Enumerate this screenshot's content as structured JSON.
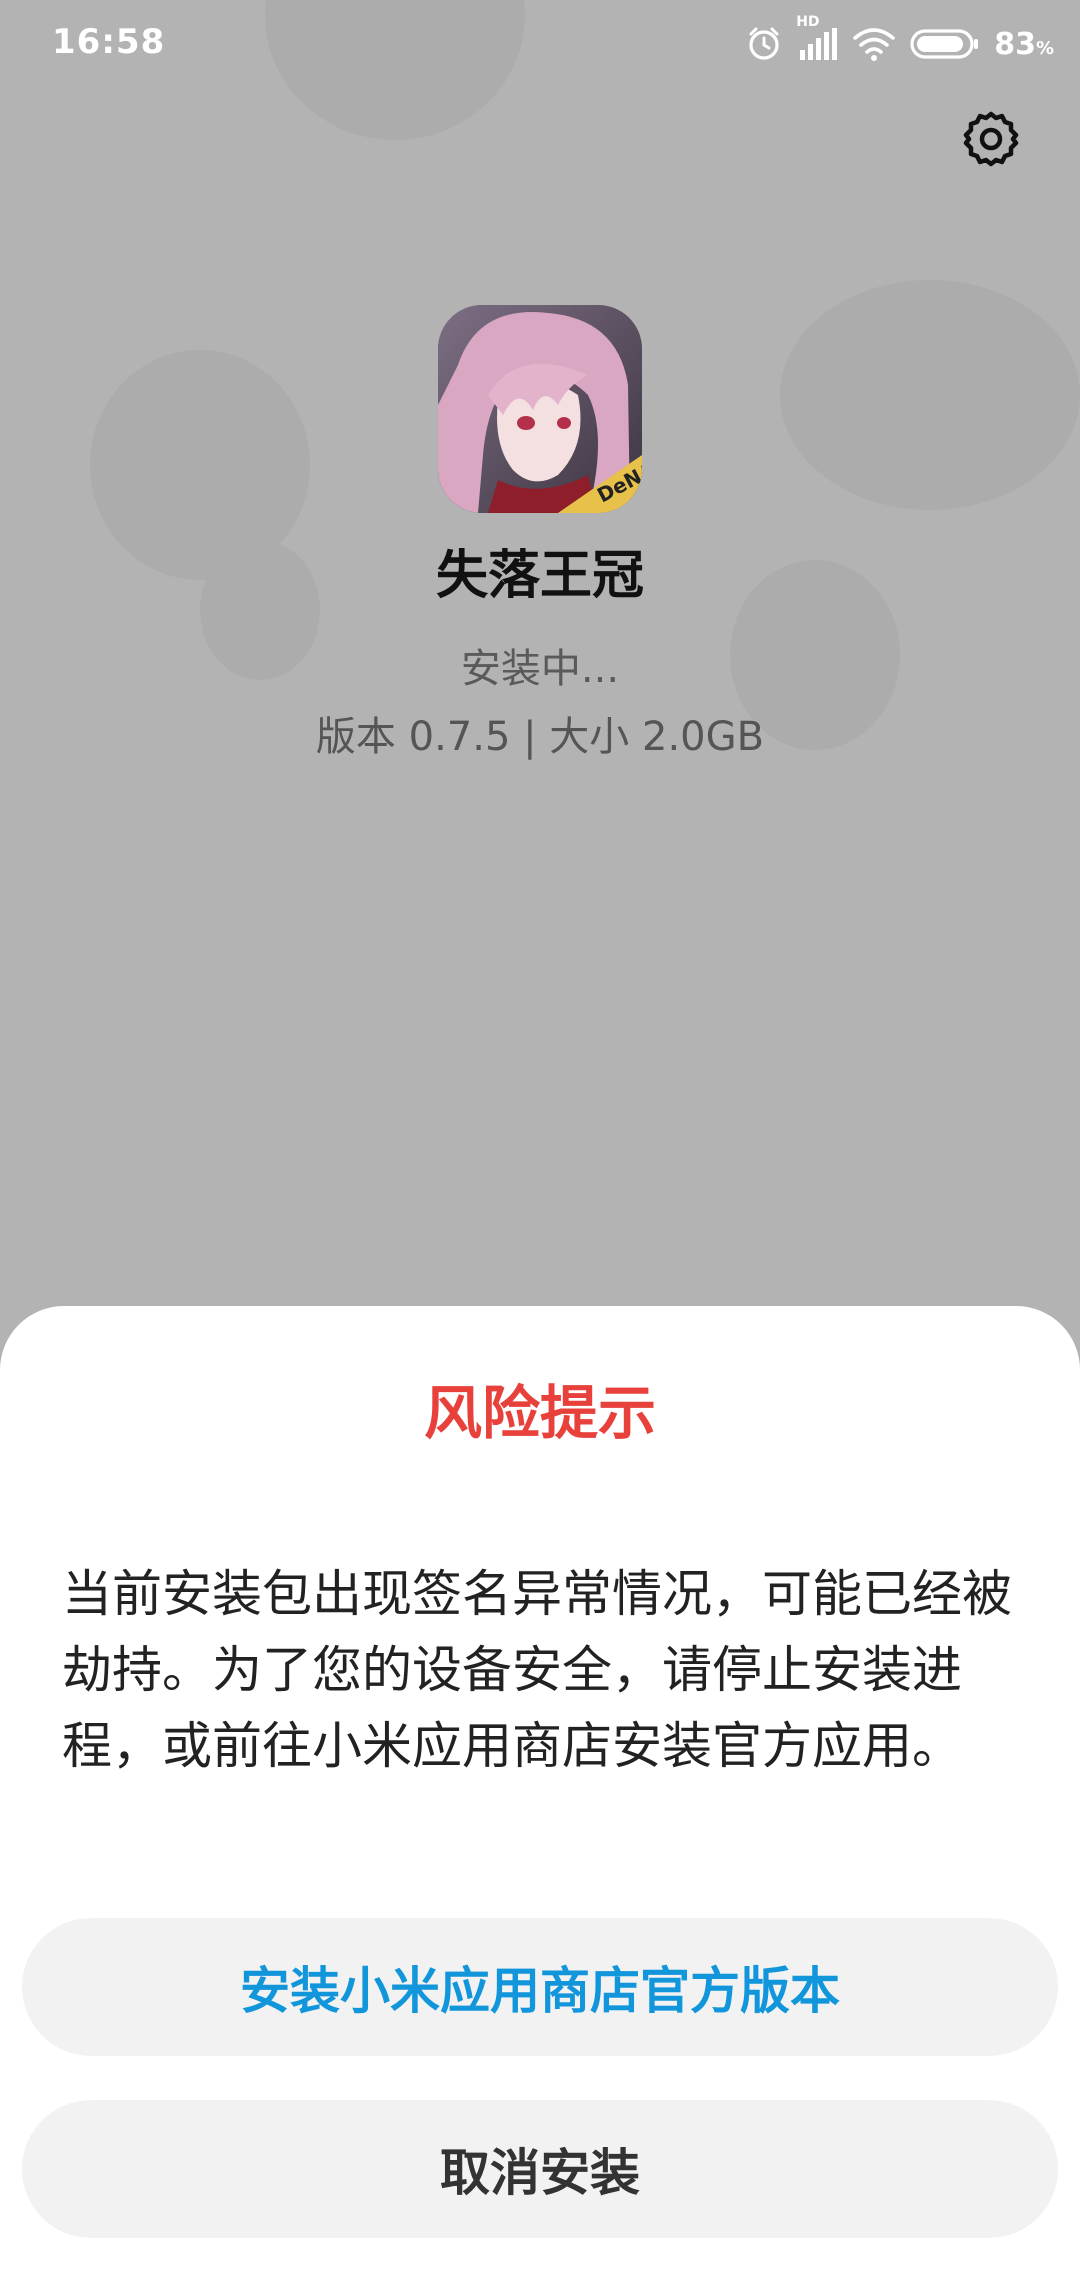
{
  "status_bar": {
    "time": "16:58",
    "battery_percent": "83",
    "battery_unit": "%",
    "network_label": "HD",
    "battery_level": 0.83,
    "icons": [
      "alarm-icon",
      "signal-icon",
      "wifi-icon",
      "battery-icon"
    ]
  },
  "toolbar": {
    "settings_icon": "gear-icon"
  },
  "app": {
    "name": "失落王冠",
    "status": "安装中...",
    "version_line": "版本 0.7.5 | 大小 2.0GB",
    "icon_badge": "DeNA"
  },
  "dialog": {
    "title": "风险提示",
    "message": "当前安装包出现签名异常情况，可能已经被劫持。为了您的设备安全，请停止安装进程，或前往小米应用商店安装官方应用。",
    "primary_button": "安装小米应用商店官方版本",
    "cancel_button": "取消安装"
  },
  "colors": {
    "title_red": "#e8403b",
    "link_blue": "#1296db",
    "overlay_gray": "#b3b3b3"
  }
}
